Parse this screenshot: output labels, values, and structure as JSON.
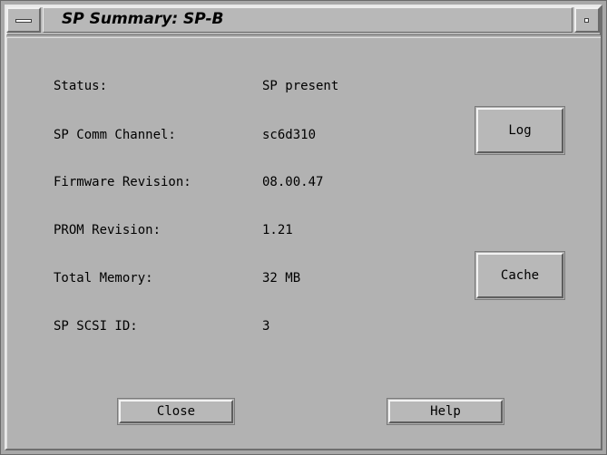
{
  "window": {
    "title": "SP Summary: SP-B"
  },
  "fields": [
    {
      "label": "Status:",
      "value": "SP present"
    },
    {
      "label": "SP Comm Channel:",
      "value": "sc6d310"
    },
    {
      "label": "Firmware Revision:",
      "value": "08.00.47"
    },
    {
      "label": "PROM Revision:",
      "value": "1.21"
    },
    {
      "label": "Total Memory:",
      "value": "32 MB"
    },
    {
      "label": "SP SCSI ID:",
      "value": "3"
    }
  ],
  "buttons": {
    "log": "Log",
    "cache": "Cache",
    "close": "Close",
    "help": "Help"
  },
  "icons": {
    "window_menu": "window-menu-icon",
    "minimize": "minimize-icon"
  },
  "colors": {
    "background": "#b4b4b4",
    "text": "#000000"
  }
}
